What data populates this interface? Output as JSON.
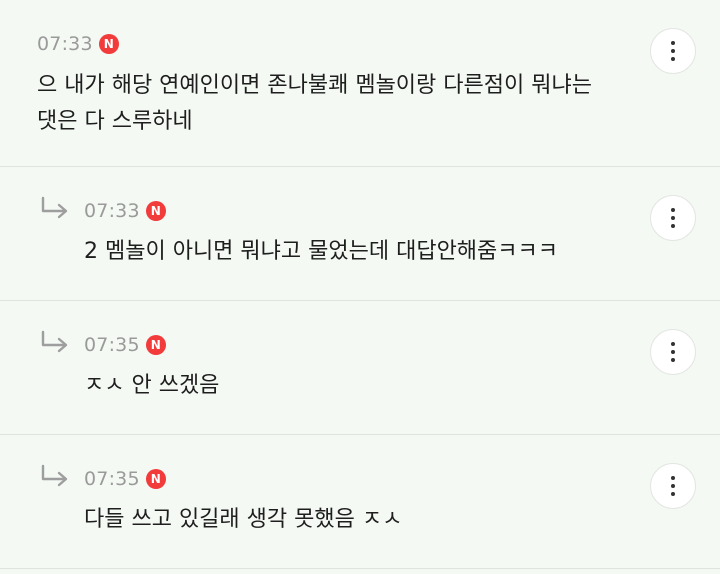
{
  "badge_label": "N",
  "colors": {
    "background": "#f4f9f4",
    "badge": "#f23b3b",
    "timestamp": "#9a9a9a",
    "text": "#1e1e1e"
  },
  "icons": {
    "reply": "reply-arrow-icon",
    "more": "more-vertical-icon"
  },
  "comments": [
    {
      "time": "07:33",
      "line1": "으 내가 해당 연예인이면 존나불쾌 멤놀이랑 다른점이 뭐냐는",
      "line2": "댓은 다 스루하네"
    },
    {
      "time": "07:33",
      "line1": "2 멤놀이 아니면 뭐냐고 물었는데 대답안해줌ㅋㅋㅋ"
    },
    {
      "time": "07:35",
      "line1": "ㅈㅅ 안 쓰겠음"
    },
    {
      "time": "07:35",
      "line1": "다들 쓰고 있길래 생각 못했음 ㅈㅅ"
    }
  ]
}
